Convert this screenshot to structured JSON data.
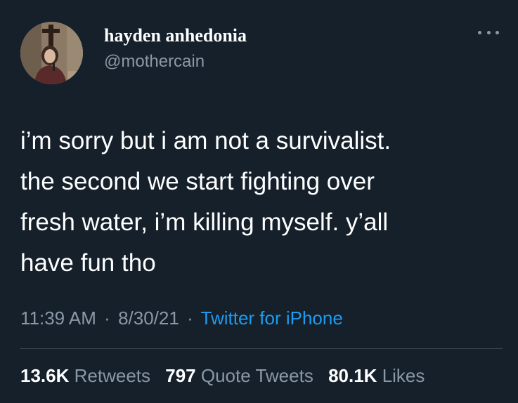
{
  "author": {
    "display_name": "hayden anhedonia",
    "handle": "@mothercain",
    "avatar": "profile-photo"
  },
  "tweet": {
    "lines": [
      "i’m sorry but i am not a survivalist.",
      "the second we start fighting over",
      "fresh water, i’m killing myself. y’all",
      "have fun tho"
    ]
  },
  "meta": {
    "time": "11:39 AM",
    "separator": "·",
    "date": "8/30/21",
    "source": "Twitter for iPhone"
  },
  "stats": {
    "retweets_count": "13.6K",
    "retweets_label": "Retweets",
    "quote_count": "797",
    "quote_label": "Quote Tweets",
    "likes_count": "80.1K",
    "likes_label": "Likes"
  },
  "colors": {
    "background": "#15202b",
    "secondary_text": "#8b98a5",
    "link": "#1d9bf0"
  }
}
